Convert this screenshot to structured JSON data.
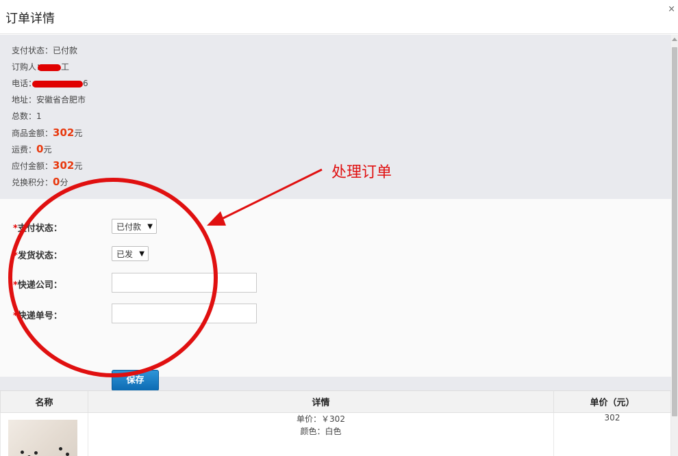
{
  "dialog": {
    "title": "订单详情",
    "close_glyph": "×"
  },
  "order_info": {
    "pay_status": "支付状态：已付款",
    "buyer_label": "订购人：",
    "buyer_tail": "工",
    "phone_label": "电话：",
    "phone_tail": "6",
    "address": "地址：安徽省合肥市",
    "total_count": "总数：1",
    "goods_amount_label": "商品金额：",
    "goods_amount_value": "302",
    "goods_amount_unit": "元",
    "shipping_label": "运费：",
    "shipping_value": "0",
    "shipping_unit": "元",
    "payable_label": "应付金额：",
    "payable_value": "302",
    "payable_unit": "元",
    "points_label": "兑换积分：",
    "points_value": "0",
    "points_unit": "分"
  },
  "form": {
    "required_mark": "*",
    "pay_status_label": "支付状态：",
    "pay_status_value": "已付款",
    "ship_status_label": "发货状态：",
    "ship_status_value": "已发",
    "courier_label": "快递公司：",
    "courier_value": "",
    "tracking_label": "快递单号：",
    "tracking_value": "",
    "save_label": "保存",
    "dropdown_arrow": "▼"
  },
  "items_table": {
    "headers": [
      "名称",
      "详情",
      "单价（元）"
    ],
    "rows": [
      {
        "detail_price": "单价：￥302",
        "detail_color": "颜色：白色",
        "price": "302"
      }
    ]
  },
  "annotation": {
    "text": "处理订单",
    "color": "#e01010"
  },
  "colors": {
    "accent_money": "#e8380d",
    "save_button": "#1a7cc4",
    "annotation_red": "#e01010"
  }
}
